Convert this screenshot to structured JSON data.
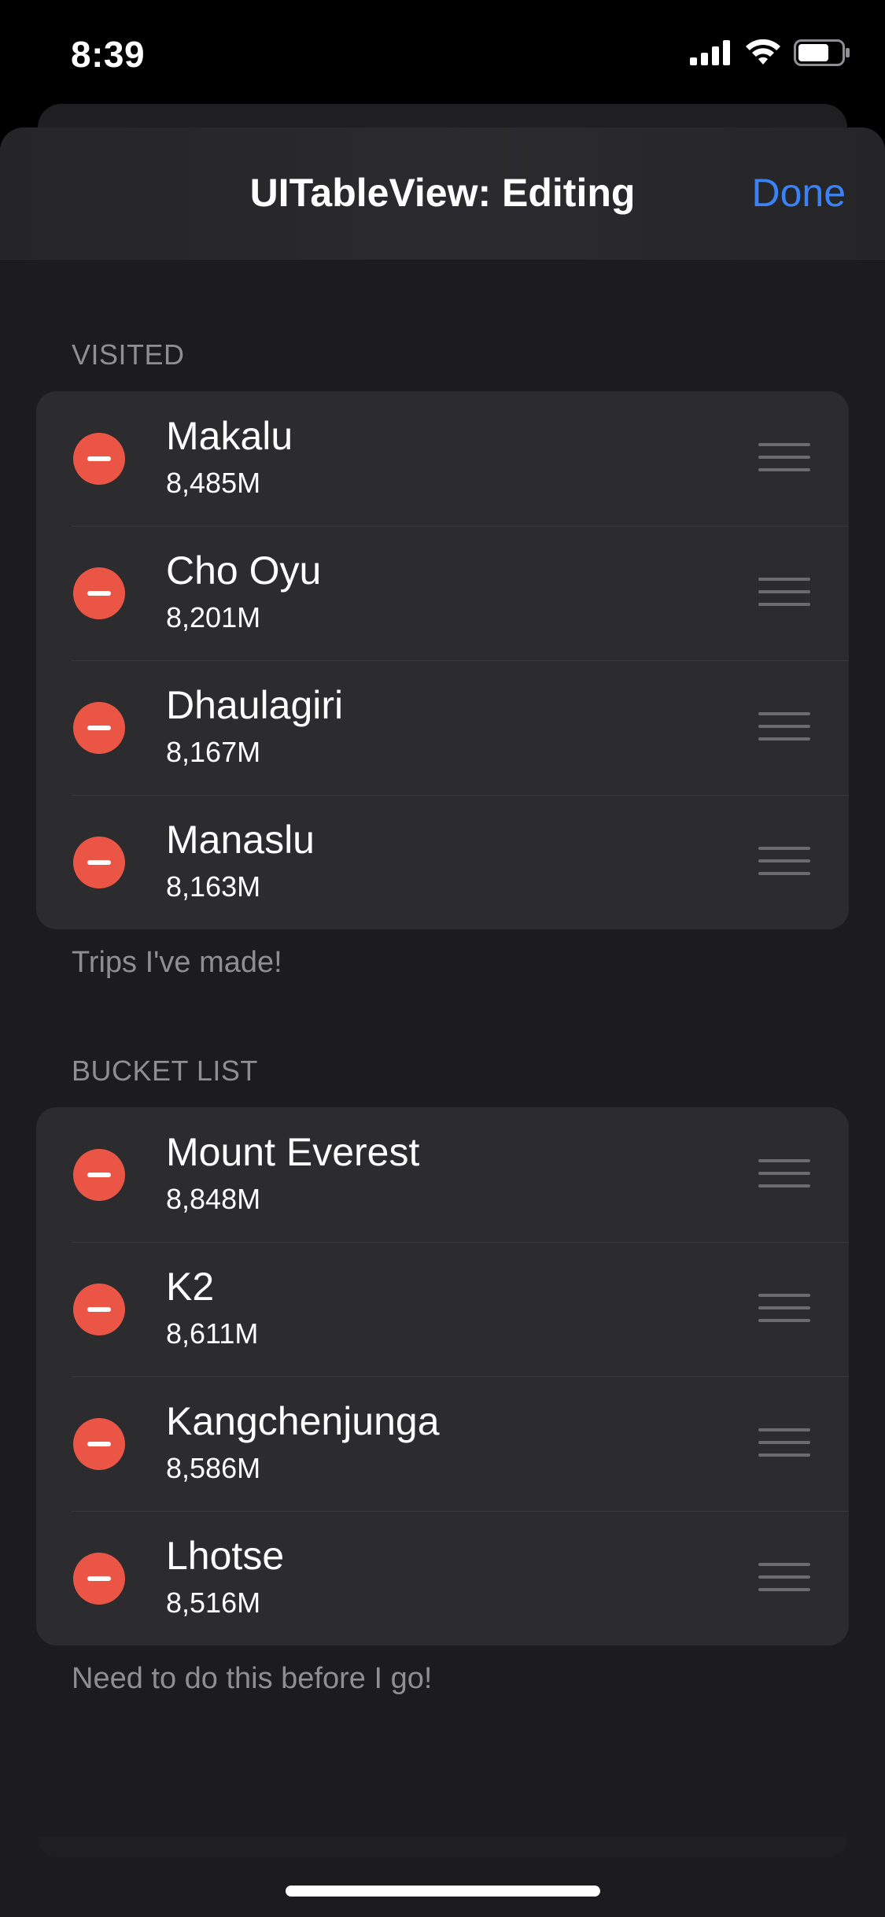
{
  "status_bar": {
    "time": "8:39"
  },
  "nav": {
    "title": "UITableView: Editing",
    "done_label": "Done"
  },
  "colors": {
    "accent": "#3b82f6",
    "delete": "#eb5545",
    "background": "#1c1c1e",
    "cell": "#2c2c2e"
  },
  "sections": [
    {
      "header": "VISITED",
      "footer": "Trips I've made!",
      "rows": [
        {
          "title": "Makalu",
          "subtitle": "8,485M"
        },
        {
          "title": "Cho Oyu",
          "subtitle": "8,201M"
        },
        {
          "title": "Dhaulagiri",
          "subtitle": "8,167M"
        },
        {
          "title": "Manaslu",
          "subtitle": "8,163M"
        }
      ]
    },
    {
      "header": "BUCKET LIST",
      "footer": "Need to do this before I go!",
      "rows": [
        {
          "title": "Mount Everest",
          "subtitle": "8,848M"
        },
        {
          "title": "K2",
          "subtitle": "8,611M"
        },
        {
          "title": "Kangchenjunga",
          "subtitle": "8,586M"
        },
        {
          "title": "Lhotse",
          "subtitle": "8,516M"
        }
      ]
    }
  ]
}
